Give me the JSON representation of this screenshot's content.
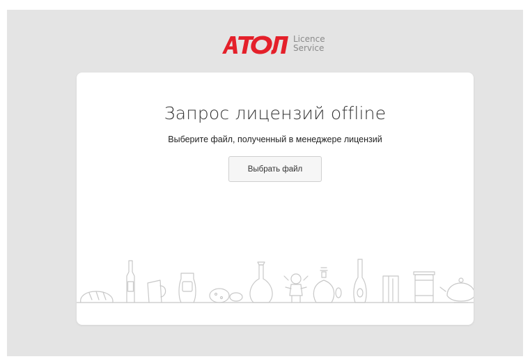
{
  "brand": {
    "name": "АТОЛ",
    "service_line1": "Licence",
    "service_line2": "Service",
    "brand_color": "#e4202a"
  },
  "card": {
    "title": "Запрос лицензий offline",
    "subtitle": "Выберите файл, полученный в менеджере лицензий",
    "choose_file_label": "Выбрать файл"
  },
  "illustration": {
    "items": [
      "bread-icon",
      "bottle-icon",
      "jug-icon",
      "jar-icon",
      "sausage-icon",
      "flask-icon",
      "toy-icon",
      "perfume-icon",
      "wine-bottle-icon",
      "box-icon",
      "can-icon",
      "teapot-icon"
    ],
    "line_color": "#c8c8c8"
  },
  "colors": {
    "page_background": "#e4e4e4",
    "card_background": "#ffffff"
  }
}
